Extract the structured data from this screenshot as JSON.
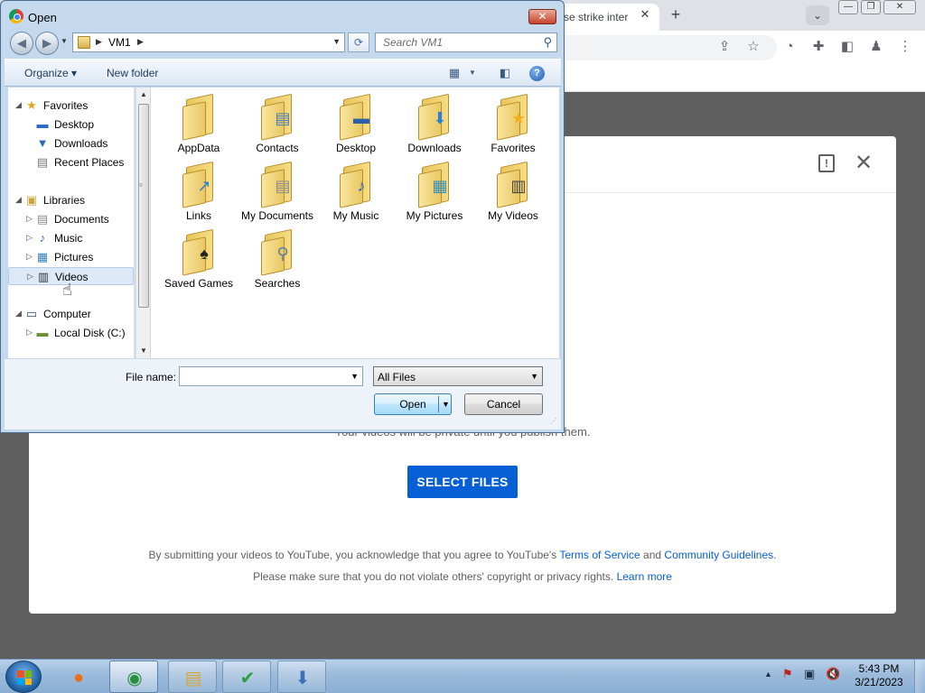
{
  "browser": {
    "tab_title": "se strike inter",
    "tab_close": "✕",
    "new_tab": "+",
    "tab_dropdown": "⌄",
    "window_buttons": [
      "—",
      "❐",
      "✕"
    ],
    "toolbar_icons": [
      "share-icon",
      "star-icon",
      "extension-icon",
      "puzzle-icon",
      "sidepanel-icon",
      "profile-icon",
      "menu-icon"
    ]
  },
  "youtube_dialog": {
    "subtitle": "Your videos will be private until you publish them.",
    "select_files": "SELECT FILES",
    "legal_line1_prefix": "By submitting your videos to YouTube, you acknowledge that you agree to YouTube's ",
    "terms_link": "Terms of Service",
    "and_text": " and ",
    "guidelines_link": "Community Guidelines",
    "period": ".",
    "legal_line2_prefix": "Please make sure that you do not violate others' copyright or privacy rights. ",
    "learn_more": "Learn more"
  },
  "open_dialog": {
    "title": "Open",
    "close": "✕",
    "address": {
      "current": "VM1",
      "search_placeholder": "Search VM1"
    },
    "commands": {
      "organize": "Organize ▾",
      "new_folder": "New folder",
      "help": "?"
    },
    "nav_tree": [
      {
        "label": "Favorites",
        "icon": "★",
        "icon_color": "#e0a820",
        "level": 0,
        "arrow": "◢"
      },
      {
        "label": "Desktop",
        "icon": "▬",
        "icon_color": "#2a6bbf",
        "level": 1
      },
      {
        "label": "Downloads",
        "icon": "▼",
        "icon_color": "#2a6bbf",
        "level": 1
      },
      {
        "label": "Recent Places",
        "icon": "▤",
        "icon_color": "#7a7a7a",
        "level": 1
      },
      {
        "label": "Libraries",
        "icon": "▣",
        "icon_color": "#c9a43f",
        "level": 0,
        "arrow": "◢"
      },
      {
        "label": "Documents",
        "icon": "▤",
        "icon_color": "#8c8c8c",
        "level": 1,
        "arrow": "▷"
      },
      {
        "label": "Music",
        "icon": "♪",
        "icon_color": "#2a6bbf",
        "level": 1,
        "arrow": "▷"
      },
      {
        "label": "Pictures",
        "icon": "▦",
        "icon_color": "#3a7fb5",
        "level": 1,
        "arrow": "▷"
      },
      {
        "label": "Videos",
        "icon": "▥",
        "icon_color": "#333333",
        "level": 1,
        "arrow": "▷",
        "selected": true
      },
      {
        "label": "Computer",
        "icon": "▭",
        "icon_color": "#2a4f80",
        "level": 0,
        "arrow": "◢"
      },
      {
        "label": "Local Disk (C:)",
        "icon": "▬",
        "icon_color": "#6b8f3c",
        "level": 1,
        "arrow": "▷"
      }
    ],
    "files": [
      {
        "name": "AppData",
        "emblem": "",
        "emblem_color": "#ffffff"
      },
      {
        "name": "Contacts",
        "emblem": "▤",
        "emblem_color": "#4a7fb8"
      },
      {
        "name": "Desktop",
        "emblem": "▬",
        "emblem_color": "#2a5fa8"
      },
      {
        "name": "Downloads",
        "emblem": "⬇",
        "emblem_color": "#2a7fd8"
      },
      {
        "name": "Favorites",
        "emblem": "★",
        "emblem_color": "#f0b020"
      },
      {
        "name": "Links",
        "emblem": "↗",
        "emblem_color": "#2a7fd8"
      },
      {
        "name": "My Documents",
        "emblem": "▤",
        "emblem_color": "#8c8c8c"
      },
      {
        "name": "My Music",
        "emblem": "♪",
        "emblem_color": "#2a6bbf"
      },
      {
        "name": "My Pictures",
        "emblem": "▦",
        "emblem_color": "#3a8fb5"
      },
      {
        "name": "My Videos",
        "emblem": "▥",
        "emblem_color": "#444444"
      },
      {
        "name": "Saved Games",
        "emblem": "♠",
        "emblem_color": "#222222"
      },
      {
        "name": "Searches",
        "emblem": "⚲",
        "emblem_color": "#5a7fa8"
      }
    ],
    "file_name_label": "File name:",
    "file_name_value": "",
    "file_type": "All Files",
    "open_button": "Open",
    "cancel_button": "Cancel"
  },
  "taskbar": {
    "items": [
      {
        "name": "firefox",
        "glyph": "●",
        "color": "#e8701a"
      },
      {
        "name": "chrome",
        "glyph": "◉",
        "color": "#2a8f3c",
        "active": true
      },
      {
        "name": "explorer",
        "glyph": "▤",
        "color": "#d4a93a"
      },
      {
        "name": "app-check",
        "glyph": "✔",
        "color": "#2a9f3c"
      },
      {
        "name": "app-installer",
        "glyph": "⬇",
        "color": "#3a6fb8"
      }
    ],
    "tray_icons": [
      "▲",
      "⚑",
      "▣",
      "🔇"
    ],
    "time": "5:43 PM",
    "date": "3/21/2023"
  },
  "colors": {
    "youtube_blue": "#065fd4",
    "win7_frame": "#c4d8ee"
  }
}
